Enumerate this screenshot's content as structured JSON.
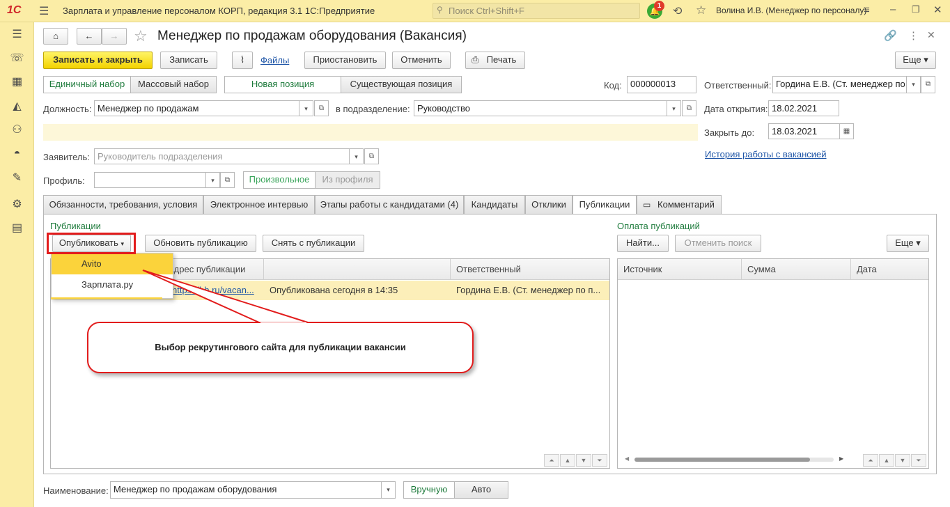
{
  "app": {
    "logo": "1С",
    "title": "Зарплата и управление персоналом КОРП, редакция 3.1 1С:Предприятие",
    "search_placeholder": "Поиск Ctrl+Shift+F",
    "notif_count": "1",
    "user": "Волина И.В. (Менеджер по персоналу)"
  },
  "sidebar": [
    "menu-icon",
    "phone-icon",
    "gift-icon",
    "graduation-icon",
    "people-icon",
    "helmet-icon",
    "wrench-icon",
    "gear-icon",
    "card-icon"
  ],
  "form": {
    "title": "Менеджер по продажам оборудования (Вакансия)",
    "more": "Еще"
  },
  "toolbar": {
    "save_close": "Записать и закрыть",
    "save": "Записать",
    "files": "Файлы",
    "suspend": "Приостановить",
    "cancel": "Отменить",
    "print": "Печать",
    "more": "Еще"
  },
  "switches": {
    "single": "Единичный набор",
    "mass": "Массовый набор",
    "new_pos": "Новая позиция",
    "existing_pos": "Существующая позиция",
    "arbitrary": "Произвольное",
    "from_profile": "Из профиля",
    "manual": "Вручную",
    "auto": "Авто"
  },
  "fields": {
    "code_label": "Код:",
    "code": "000000013",
    "responsible_label": "Ответственный:",
    "responsible": "Гордина Е.В. (Ст. менеджер по",
    "position_label": "Должность:",
    "position": "Менеджер по продажам",
    "dept_label": "в подразделение:",
    "dept": "Руководство",
    "open_date_label": "Дата открытия:",
    "open_date": "18.02.2021",
    "close_by_label": "Закрыть до:",
    "close_by": "18.03.2021",
    "history_link": "История работы с вакансией",
    "applicant_label": "Заявитель:",
    "applicant_placeholder": "Руководитель подразделения",
    "profile_label": "Профиль:",
    "name_label": "Наименование:",
    "name": "Менеджер по продажам оборудования"
  },
  "tabs": [
    "Обязанности, требования, условия",
    "Электронное интервью",
    "Этапы работы с кандидатами (4)",
    "Кандидаты",
    "Отклики",
    "Публикации",
    "Комментарий"
  ],
  "publications": {
    "group": "Публикации",
    "publish": "Опубликовать",
    "update": "Обновить публикацию",
    "withdraw": "Снять с публикации",
    "col_address": "Адрес публикации",
    "col_status": "",
    "col_responsible": "Ответственный",
    "row_address": "https://hh.ru/vacan...",
    "row_status": "Опубликована сегодня в 14:35",
    "row_responsible": "Гордина Е.В. (Ст. менеджер по п..."
  },
  "dropdown": [
    "Avito",
    "Зарплата.ру"
  ],
  "payment": {
    "group": "Оплата публикаций",
    "find": "Найти...",
    "cancel_search": "Отменить поиск",
    "more": "Еще",
    "col_source": "Источник",
    "col_sum": "Сумма",
    "col_date": "Дата"
  },
  "callout": "Выбор рекрутингового сайта для публикации вакансии"
}
